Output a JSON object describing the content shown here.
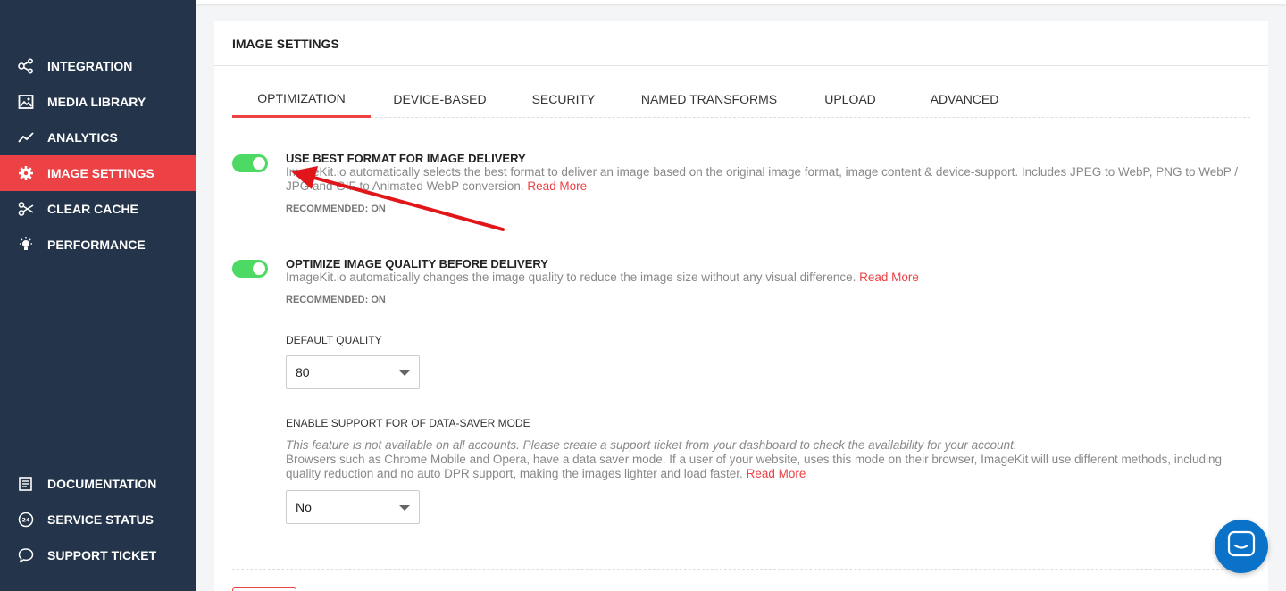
{
  "sidebar": {
    "top_items": [
      {
        "label": "INTEGRATION",
        "icon": "share-icon"
      },
      {
        "label": "MEDIA LIBRARY",
        "icon": "image-icon"
      },
      {
        "label": "ANALYTICS",
        "icon": "chart-line-icon"
      },
      {
        "label": "IMAGE SETTINGS",
        "icon": "gear-icon",
        "active": true
      },
      {
        "label": "CLEAR CACHE",
        "icon": "scissors-icon"
      },
      {
        "label": "PERFORMANCE",
        "icon": "lightbulb-icon"
      }
    ],
    "bottom_items": [
      {
        "label": "DOCUMENTATION",
        "icon": "document-icon"
      },
      {
        "label": "SERVICE STATUS",
        "icon": "clock-24-icon"
      },
      {
        "label": "SUPPORT TICKET",
        "icon": "chat-icon"
      }
    ]
  },
  "card": {
    "title": "IMAGE SETTINGS",
    "tabs": [
      "OPTIMIZATION",
      "DEVICE-BASED",
      "SECURITY",
      "NAMED TRANSFORMS",
      "UPLOAD",
      "ADVANCED"
    ],
    "active_tab": "OPTIMIZATION"
  },
  "settings": {
    "best_format": {
      "title": "USE BEST FORMAT FOR IMAGE DELIVERY",
      "description": "ImageKit.io automatically selects the best format to deliver an image based on the original image format, image content & device-support. Includes JPEG to WebP, PNG to WebP / JPG and GIF to Animated WebP conversion.",
      "read_more": "Read More",
      "recommended": "RECOMMENDED: ON",
      "enabled": true
    },
    "optimize_quality": {
      "title": "OPTIMIZE IMAGE QUALITY BEFORE DELIVERY",
      "description": "ImageKit.io automatically changes the image quality to reduce the image size without any visual difference.",
      "read_more": "Read More",
      "recommended": "RECOMMENDED: ON",
      "enabled": true
    },
    "default_quality": {
      "label": "DEFAULT QUALITY",
      "value": "80"
    },
    "data_saver": {
      "label": "ENABLE SUPPORT FOR OF DATA-SAVER MODE",
      "note": "This feature is not available on all accounts. Please create a support ticket from your dashboard to check the availability for your account.",
      "description": "Browsers such as Chrome Mobile and Opera, have a data saver mode. If a user of your website, uses this mode on their browser, ImageKit will use different methods, including quality reduction and no auto DPR support, making the images lighter and load faster.",
      "read_more": "Read More",
      "value": "No"
    }
  },
  "colors": {
    "sidebar_bg": "#24344a",
    "accent": "#ec4145",
    "toggle_on": "#4cd964",
    "chat": "#0b72c9"
  }
}
